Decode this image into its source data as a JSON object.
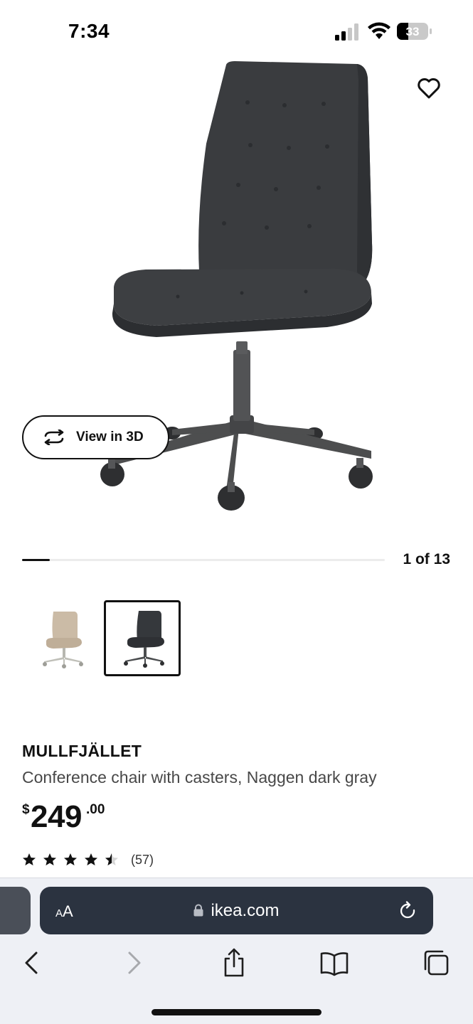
{
  "status_bar": {
    "time": "7:34",
    "battery": "33"
  },
  "product": {
    "name": "MULLFJÄLLET",
    "description": "Conference chair with casters, Naggen dark gray",
    "price": {
      "currency": "$",
      "whole": "249",
      "cents": ".00"
    },
    "rating": {
      "stars": 4.5,
      "max_stars": 5,
      "review_count": "(57)"
    },
    "view_3d_label": "View in 3D",
    "favorite_icon": "heart-icon"
  },
  "gallery": {
    "page_indicator": "1 of 13",
    "progress_fraction": 0.077
  },
  "variants": [
    {
      "color_name": "beige",
      "chair_color": "#cbbba6",
      "base_color": "#bfbfb8",
      "selected": false
    },
    {
      "color_name": "dark gray",
      "chair_color": "#35383c",
      "base_color": "#4a4c4e",
      "selected": true
    }
  ],
  "browser": {
    "aa_small": "A",
    "aa_big": "A",
    "url": "ikea.com",
    "toolbar_icons": [
      "back-icon",
      "forward-icon",
      "share-icon",
      "bookmarks-icon",
      "tabs-icon"
    ]
  },
  "colors": {
    "address_bar": "#2b3340",
    "toolbar_bg": "#eef0f5",
    "chair_fabric": "#3a3c3f",
    "chair_frame": "#4d4e4f"
  }
}
